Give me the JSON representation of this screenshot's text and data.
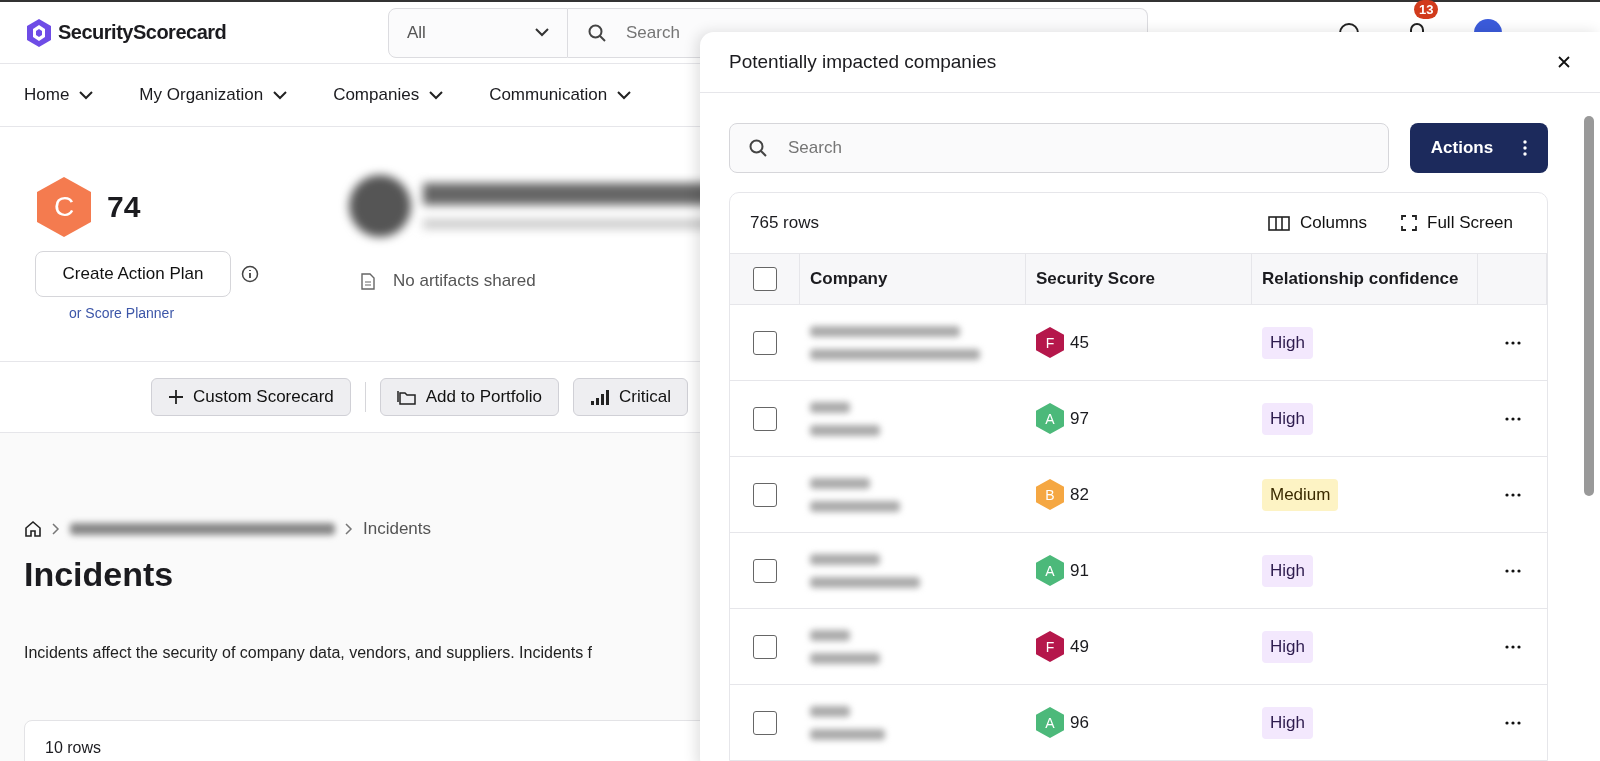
{
  "header": {
    "brand": "SecurityScorecard",
    "scope_select": {
      "value": "All"
    },
    "search": {
      "placeholder": "Search"
    },
    "notifications_count": "13"
  },
  "nav": [
    {
      "label": "Home"
    },
    {
      "label": "My Organization"
    },
    {
      "label": "Companies"
    },
    {
      "label": "Communication"
    }
  ],
  "company": {
    "grade": "C",
    "score": "74",
    "create_action_plan": "Create Action Plan",
    "score_planner_link": "or Score Planner",
    "artifacts": "No artifacts shared"
  },
  "toolbar": [
    "Custom Scorecard",
    "Add to Portfolio",
    "Critical"
  ],
  "breadcrumb": {
    "current": "Incidents"
  },
  "page": {
    "title": "Incidents",
    "description": "Incidents affect the security of company data, vendors, and suppliers. Incidents f",
    "rows_count": "10 rows"
  },
  "panel": {
    "title": "Potentially impacted companies",
    "search": {
      "placeholder": "Search"
    },
    "actions_button": "Actions",
    "rows_count": "765 rows",
    "columns_button": "Columns",
    "full_screen_button": "Full Screen",
    "table": {
      "header_checked": false,
      "columns": [
        "Company",
        "Security Score",
        "Relationship confidence"
      ],
      "rows": [
        {
          "checked": false,
          "grade": "F",
          "color": "#b5174b",
          "score": "45",
          "confidence": "High",
          "kind": "high"
        },
        {
          "checked": false,
          "grade": "A",
          "color": "#4cb97a",
          "score": "97",
          "confidence": "High",
          "kind": "high"
        },
        {
          "checked": false,
          "grade": "B",
          "color": "#f5a742",
          "score": "82",
          "confidence": "Medium",
          "kind": "medium"
        },
        {
          "checked": false,
          "grade": "A",
          "color": "#4cb97a",
          "score": "91",
          "confidence": "High",
          "kind": "high"
        },
        {
          "checked": false,
          "grade": "F",
          "color": "#b5174b",
          "score": "49",
          "confidence": "High",
          "kind": "high"
        },
        {
          "checked": false,
          "grade": "A",
          "color": "#4cb97a",
          "score": "96",
          "confidence": "High",
          "kind": "high"
        }
      ]
    }
  }
}
